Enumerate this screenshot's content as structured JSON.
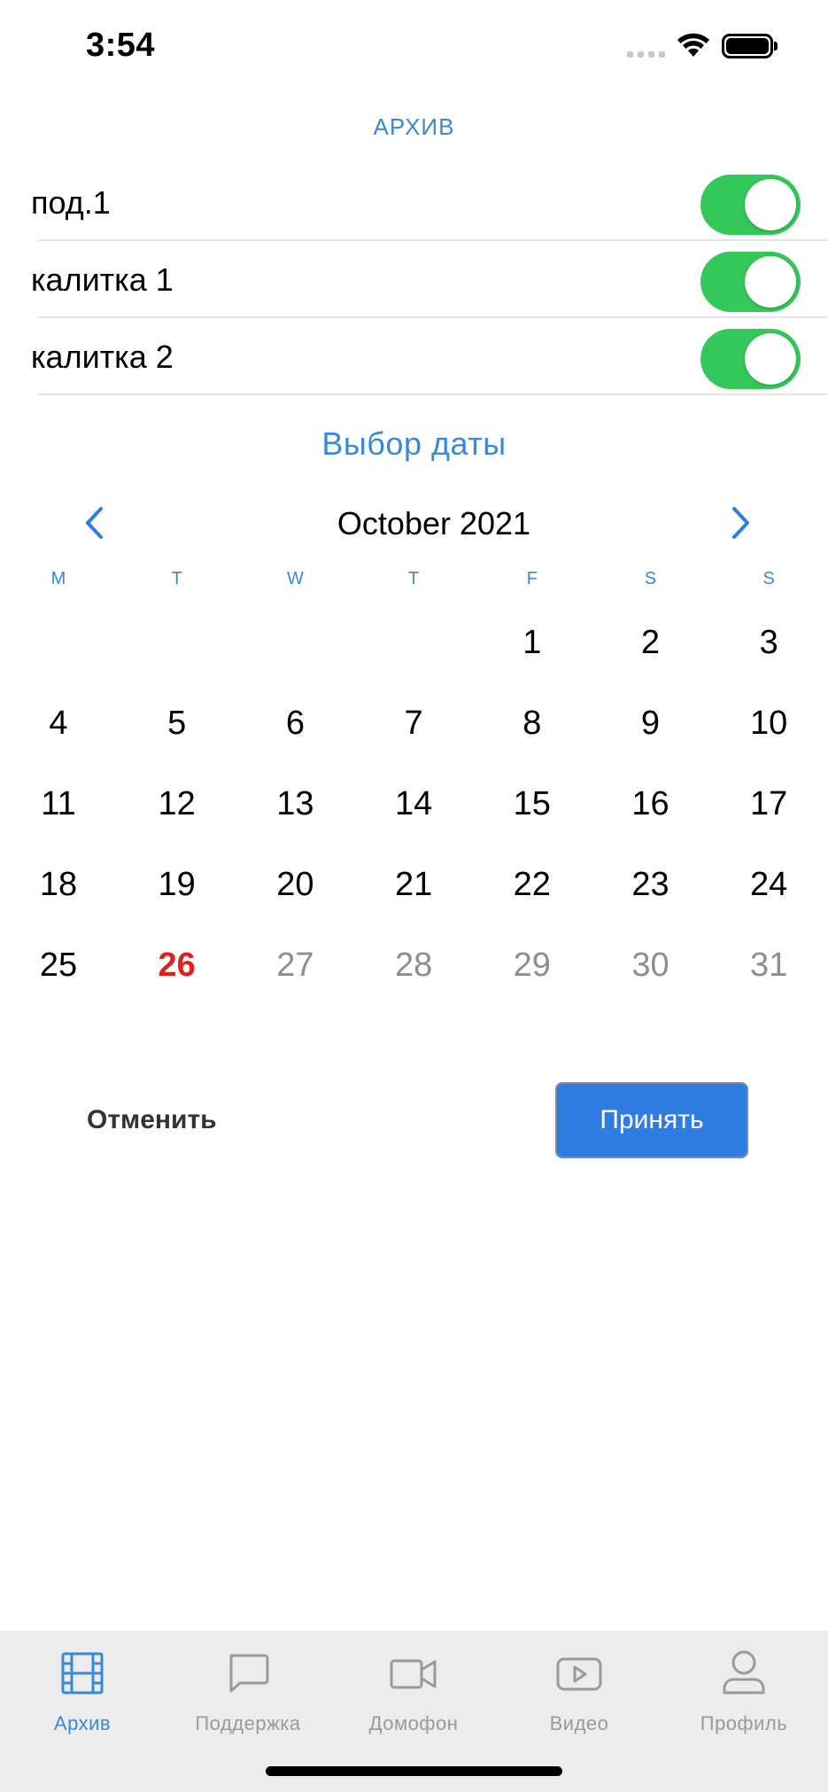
{
  "status_bar": {
    "time": "3:54"
  },
  "archive_title": "АРХИВ",
  "cameras": [
    {
      "label": "под.1",
      "enabled": true
    },
    {
      "label": "калитка 1",
      "enabled": true
    },
    {
      "label": "калитка 2",
      "enabled": true
    }
  ],
  "date_picker": {
    "title": "Выбор даты",
    "month_label": "October 2021",
    "weekdays": [
      "M",
      "T",
      "W",
      "T",
      "F",
      "S",
      "S"
    ],
    "weeks": [
      [
        "",
        "",
        "",
        "",
        "1",
        "2",
        "3"
      ],
      [
        "4",
        "5",
        "6",
        "7",
        "8",
        "9",
        "10"
      ],
      [
        "11",
        "12",
        "13",
        "14",
        "15",
        "16",
        "17"
      ],
      [
        "18",
        "19",
        "20",
        "21",
        "22",
        "23",
        "24"
      ],
      [
        "25",
        "26",
        "27",
        "28",
        "29",
        "30",
        "31"
      ]
    ],
    "today": "26",
    "disabled_days": [
      "27",
      "28",
      "29",
      "30",
      "31"
    ]
  },
  "actions": {
    "cancel_label": "Отменить",
    "accept_label": "Принять"
  },
  "tabbar": {
    "items": [
      {
        "label": "Архив",
        "icon": "film-icon",
        "active": true
      },
      {
        "label": "Поддержка",
        "icon": "chat-bubble-icon",
        "active": false
      },
      {
        "label": "Домофон",
        "icon": "video-camera-icon",
        "active": false
      },
      {
        "label": "Видео",
        "icon": "play-video-icon",
        "active": false
      },
      {
        "label": "Профиль",
        "icon": "profile-icon",
        "active": false
      }
    ]
  },
  "colors": {
    "accent": "#3a89d6",
    "toggle_on": "#34c759",
    "today": "#e0201f",
    "accept_button": "#2f7de3"
  }
}
